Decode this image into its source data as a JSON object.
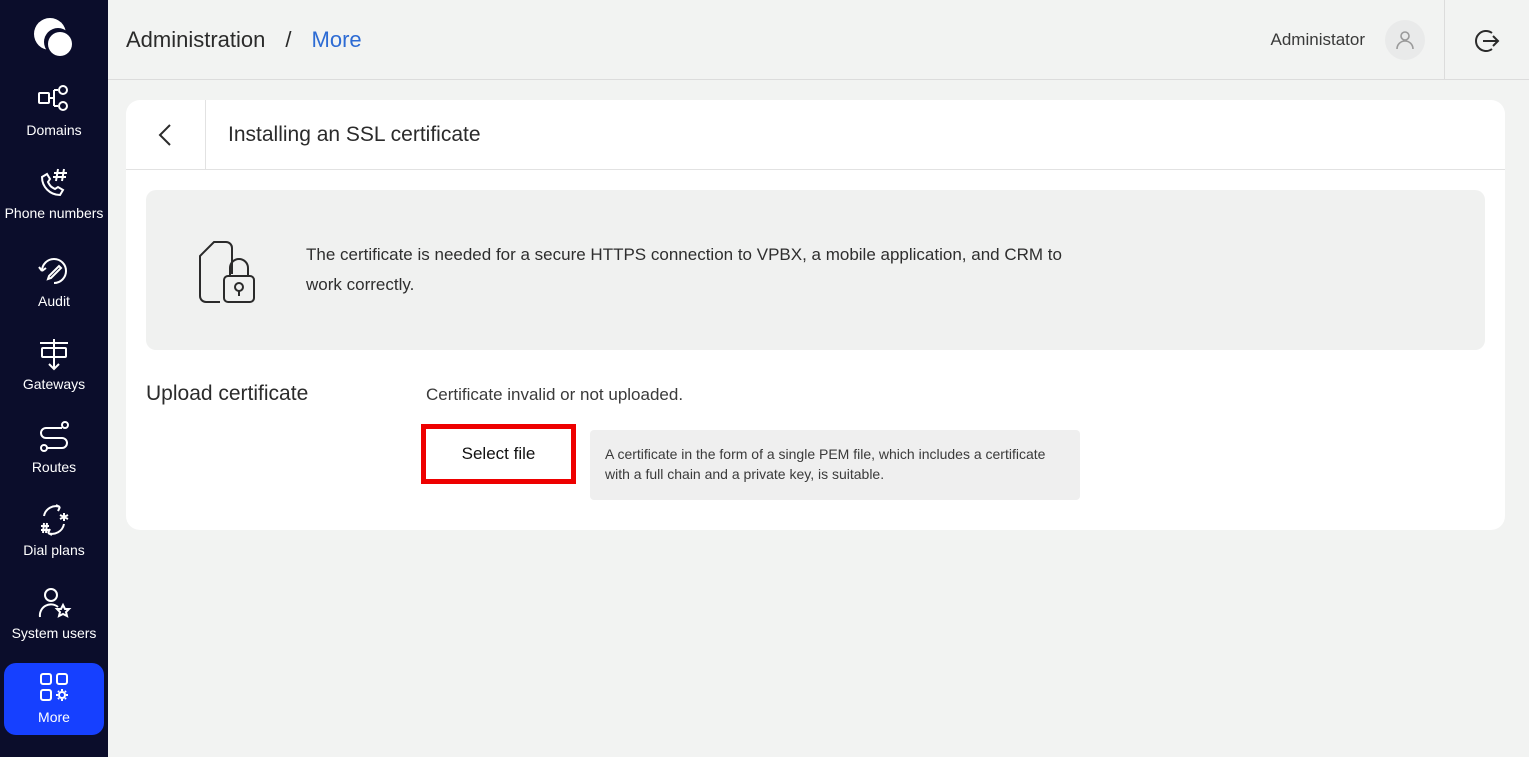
{
  "sidebar": {
    "items": [
      {
        "label": "Domains",
        "icon": "domains-icon"
      },
      {
        "label": "Phone numbers",
        "icon": "phone-hash-icon"
      },
      {
        "label": "Audit",
        "icon": "audit-icon"
      },
      {
        "label": "Gateways",
        "icon": "gateways-icon"
      },
      {
        "label": "Routes",
        "icon": "routes-icon"
      },
      {
        "label": "Dial plans",
        "icon": "dial-plans-icon"
      },
      {
        "label": "System users",
        "icon": "system-users-icon"
      },
      {
        "label": "More",
        "icon": "more-grid-icon",
        "active": true
      }
    ]
  },
  "header": {
    "breadcrumb_root": "Administration",
    "breadcrumb_separator": "/",
    "breadcrumb_current": "More",
    "user_name": "Administator"
  },
  "card": {
    "title": "Installing an SSL certificate",
    "info_text": "The certificate is needed for a secure HTTPS connection to VPBX, a mobile application, and CRM to work correctly.",
    "upload_label": "Upload certificate",
    "status_text": "Certificate invalid or not uploaded.",
    "select_button": "Select file",
    "hint": "A certificate in the form of a single PEM file, which includes a certificate with a full chain and a private key, is suitable."
  },
  "colors": {
    "sidebar_bg": "#0b0d2b",
    "active_nav": "#1640ff",
    "link": "#2d6bd4",
    "highlight_border": "#ee0000"
  }
}
